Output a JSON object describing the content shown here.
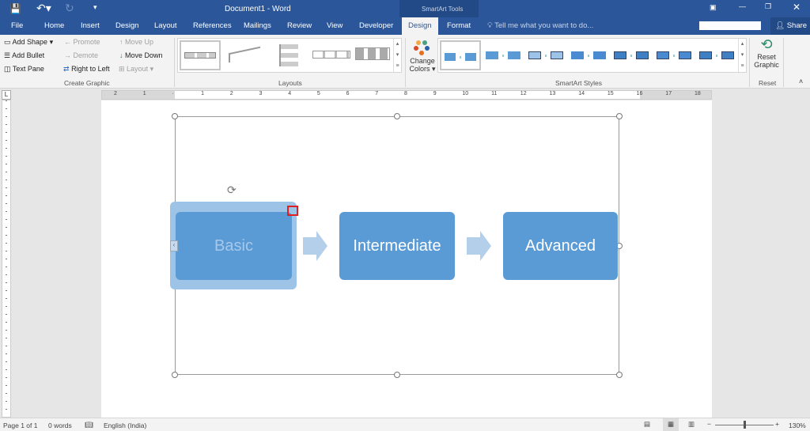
{
  "title": "Document1 - Word",
  "context_group": "SmartArt Tools",
  "tabs": [
    "File",
    "Home",
    "Insert",
    "Design",
    "Layout",
    "References",
    "Mailings",
    "Review",
    "View",
    "Developer",
    "Design",
    "Format"
  ],
  "tell_me": "Tell me what you want to do...",
  "share": "Share",
  "create_graphic": {
    "add_shape": "Add Shape",
    "add_bullet": "Add Bullet",
    "text_pane": "Text Pane",
    "promote": "Promote",
    "demote": "Demote",
    "right_to_left": "Right to Left",
    "move_up": "Move Up",
    "move_down": "Move Down",
    "layout": "Layout",
    "group": "Create Graphic"
  },
  "layouts_group": "Layouts",
  "change_colors": [
    "Change",
    "Colors"
  ],
  "styles_group": "SmartArt Styles",
  "reset": {
    "line1": "Reset",
    "line2": "Graphic",
    "group": "Reset"
  },
  "ruler_numbers": [
    "2",
    "1",
    "",
    "1",
    "2",
    "3",
    "4",
    "5",
    "6",
    "7",
    "8",
    "9",
    "10",
    "11",
    "12",
    "13",
    "14",
    "15",
    "16",
    "17",
    "18"
  ],
  "smartart": {
    "items": [
      "Basic",
      "Intermediate",
      "Advanced"
    ],
    "color": "#5b9bd5"
  },
  "status": {
    "page": "Page 1 of 1",
    "words": "0 words",
    "language": "English (India)",
    "zoom": "130%"
  }
}
